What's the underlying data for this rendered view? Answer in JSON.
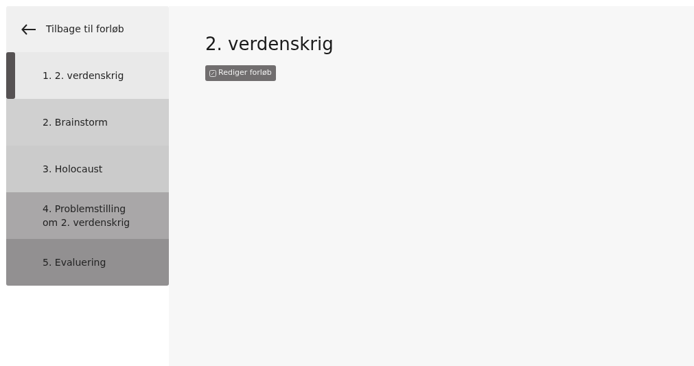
{
  "back_link": {
    "label": "Tilbage til forløb"
  },
  "sidebar": {
    "items": [
      {
        "label": "1. 2. verdenskrig",
        "selected": true,
        "color": "#e9e9e9"
      },
      {
        "label": "2. Brainstorm",
        "selected": false,
        "color": "#d0d0d0"
      },
      {
        "label": "3. Holocaust",
        "selected": false,
        "color": "#cbcbcb"
      },
      {
        "label": "4. Problemstilling om 2. verdenskrig",
        "selected": false,
        "color": "#a9a7a8"
      },
      {
        "label": "5. Evaluering",
        "selected": false,
        "color": "#929091"
      }
    ]
  },
  "main": {
    "title": "2. verdenskrig",
    "edit_button": {
      "label": "Rediger forløb"
    }
  }
}
